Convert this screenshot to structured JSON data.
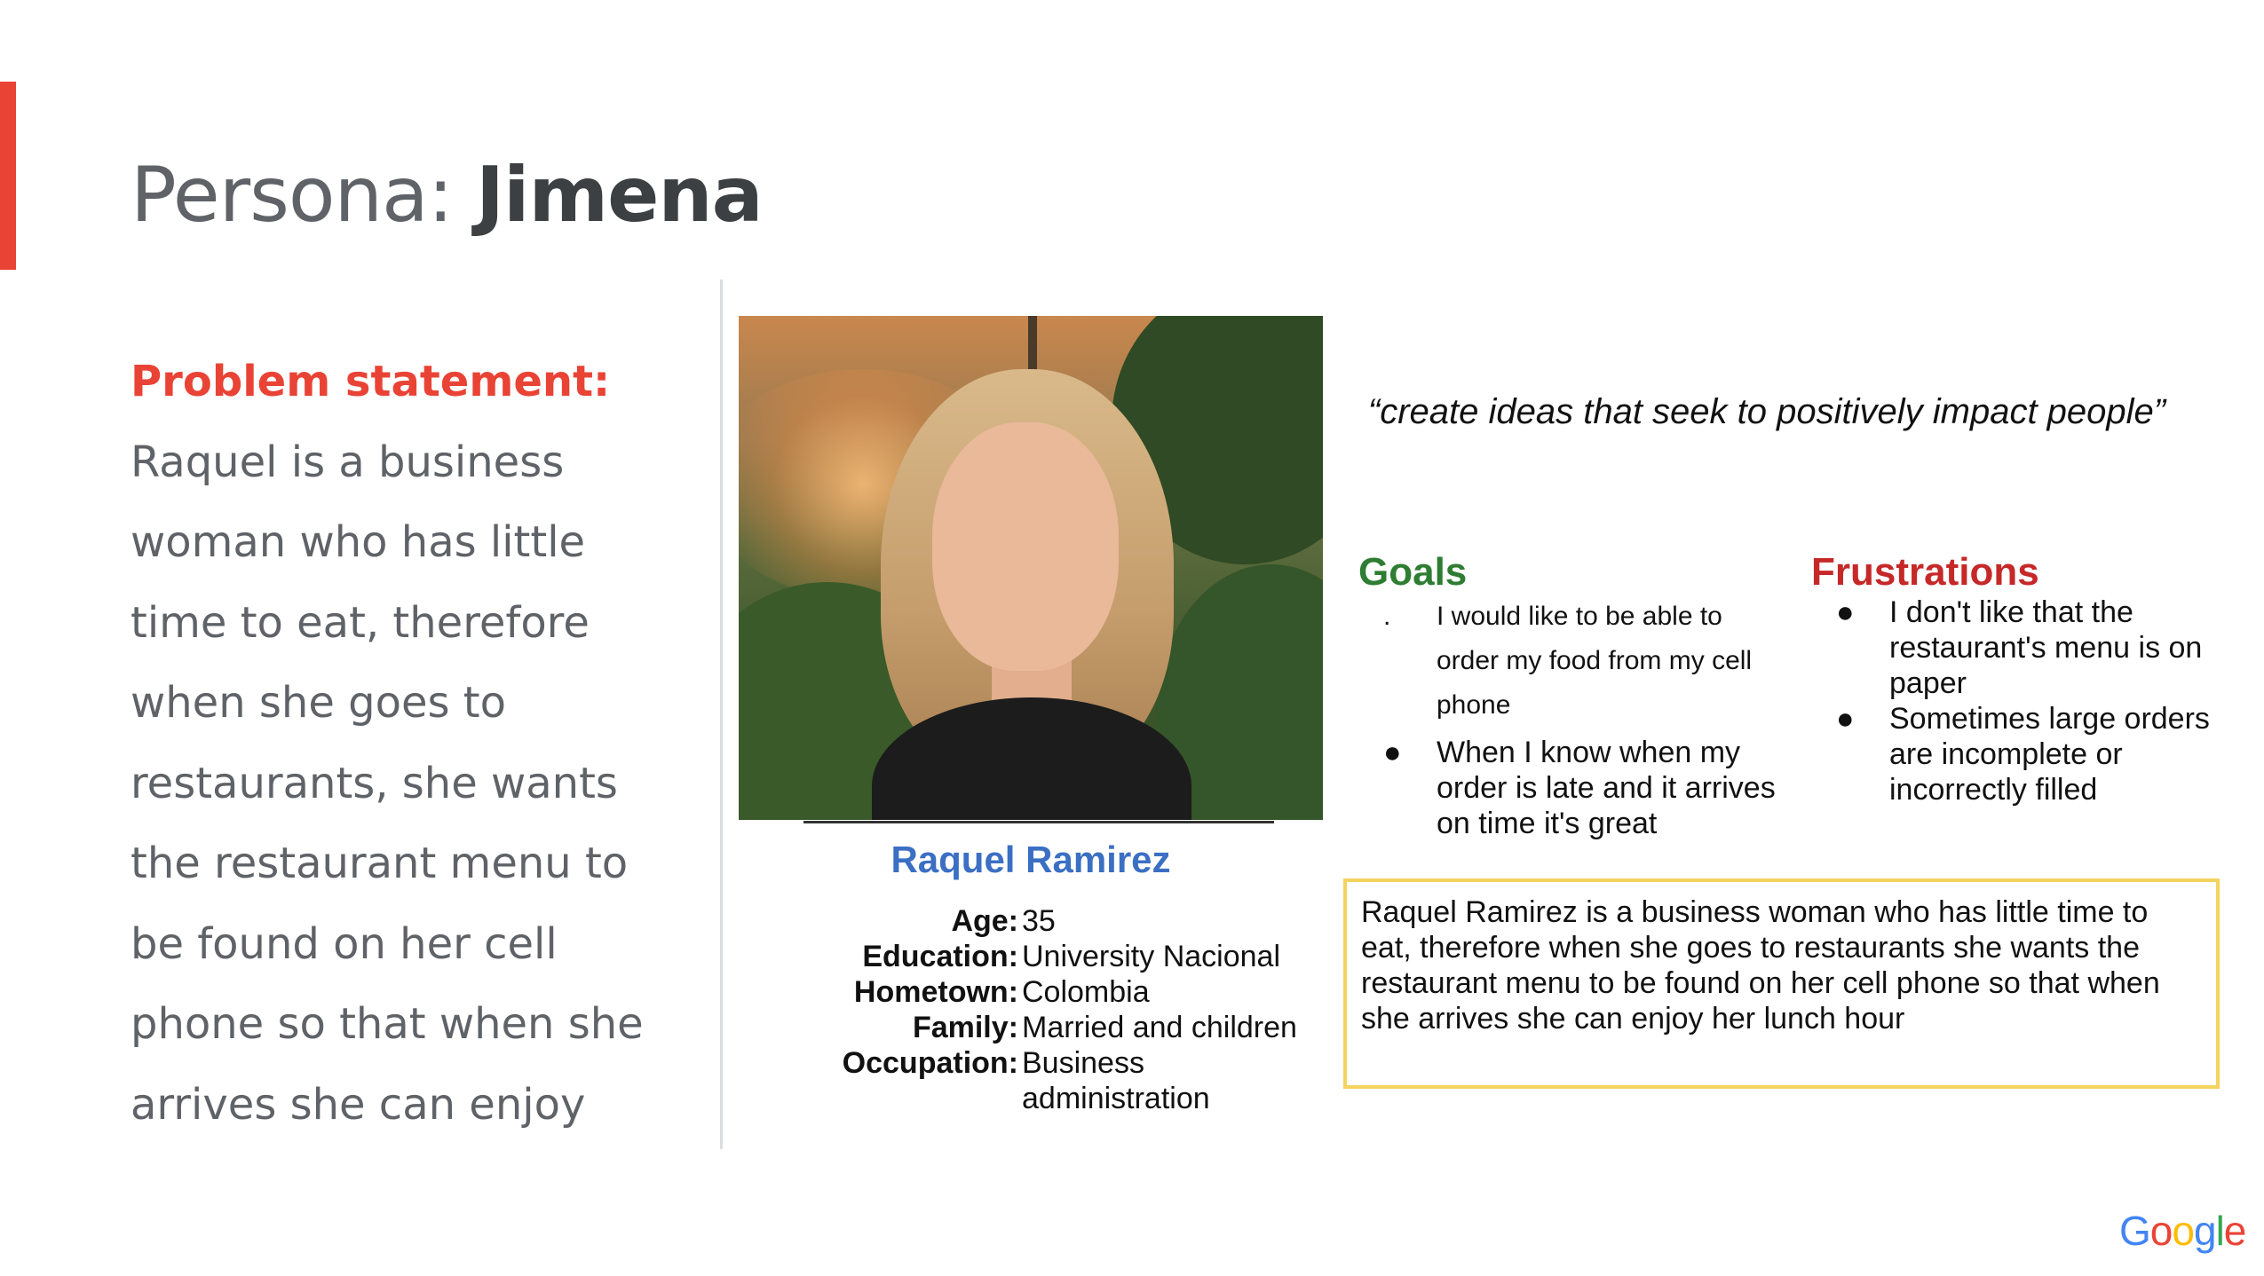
{
  "slide": {
    "title_prefix": "Persona: ",
    "title_name": "Jimena",
    "accent_color": "#e94335"
  },
  "problem": {
    "label": "Problem statement:",
    "text": "Raquel is a business woman who has little time to eat, therefore when she goes to restaurants, she wants the restaurant menu to be found on her cell phone so that when she arrives she can enjoy"
  },
  "persona": {
    "name": "Raquel Ramirez",
    "facts": [
      {
        "key": "Age:",
        "value": "35"
      },
      {
        "key": "Education:",
        "value": "University Nacional"
      },
      {
        "key": "Hometown:",
        "value": "Colombia"
      },
      {
        "key": "Family:",
        "value": "Married and children"
      },
      {
        "key": "Occupation:",
        "value": "Business administration"
      }
    ]
  },
  "quote": "“create  ideas that seek to positively impact people”",
  "goals": {
    "heading": "Goals",
    "items": [
      {
        "bullet": ".",
        "text": "I would like to be able to order my food from my cell phone"
      },
      {
        "bullet": "●",
        "text": "When I know when my order is late and it arrives on time it's great"
      }
    ]
  },
  "frustrations": {
    "heading": "Frustrations",
    "items": [
      {
        "bullet": "●",
        "text": "I don't like that the restaurant's menu is on paper"
      },
      {
        "bullet": "●",
        "text": "Sometimes large orders are incomplete or incorrectly filled"
      }
    ]
  },
  "summary": "Raquel Ramirez is a business woman who has little time to eat, therefore  when she goes to restaurants she wants the restaurant menu to be found on her cell phone so that when she arrives she can enjoy her lunch hour",
  "brand": {
    "letters": [
      "G",
      "o",
      "o",
      "g",
      "l",
      "e"
    ]
  }
}
